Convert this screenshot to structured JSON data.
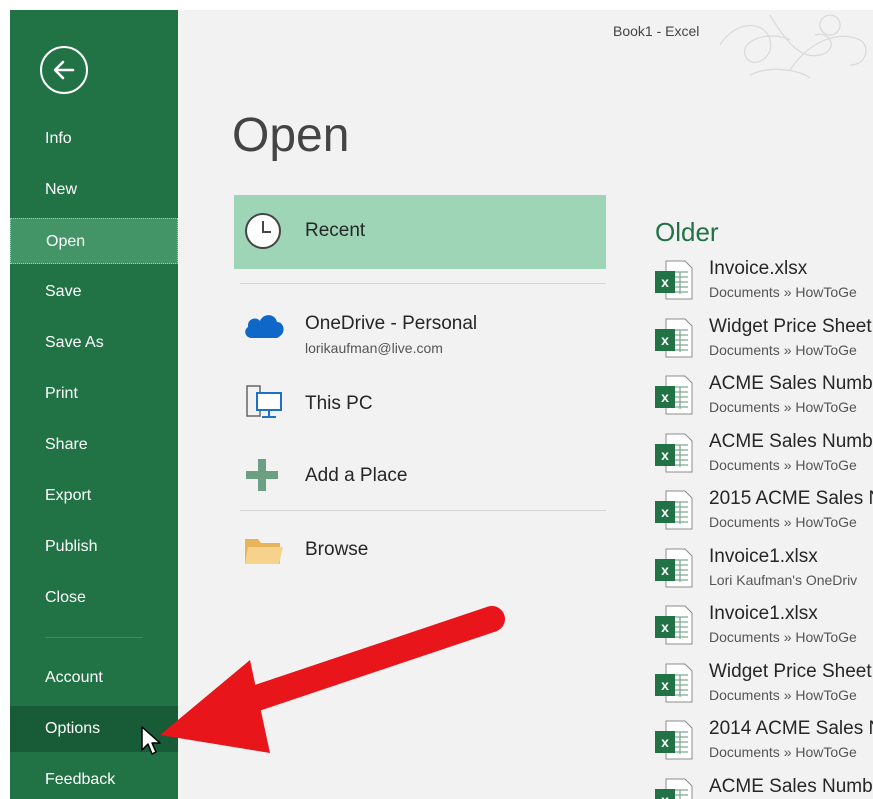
{
  "window": {
    "title": "Book1 - Excel"
  },
  "sidebar": {
    "back_label": "Back",
    "items": [
      {
        "label": "Info"
      },
      {
        "label": "New"
      },
      {
        "label": "Open"
      },
      {
        "label": "Save"
      },
      {
        "label": "Save As"
      },
      {
        "label": "Print"
      },
      {
        "label": "Share"
      },
      {
        "label": "Export"
      },
      {
        "label": "Publish"
      },
      {
        "label": "Close"
      },
      {
        "label": "Account"
      },
      {
        "label": "Options"
      },
      {
        "label": "Feedback"
      }
    ],
    "active_item": "Open",
    "highlighted_item": "Options"
  },
  "main": {
    "title": "Open",
    "places": {
      "recent": {
        "label": "Recent",
        "icon": "clock-icon"
      },
      "onedrive": {
        "label": "OneDrive - Personal",
        "account": "lorikaufman@live.com",
        "icon": "cloud-icon"
      },
      "this_pc": {
        "label": "This PC",
        "icon": "computer-icon"
      },
      "add_place": {
        "label": "Add a Place",
        "icon": "plus-icon"
      },
      "browse": {
        "label": "Browse",
        "icon": "folder-icon"
      }
    },
    "section_heading": "Older",
    "files": [
      {
        "name": "Invoice.xlsx",
        "path": "Documents » HowToGe"
      },
      {
        "name": "Widget Price Sheet",
        "path": "Documents » HowToGe"
      },
      {
        "name": "ACME Sales Numb",
        "path": "Documents » HowToGe"
      },
      {
        "name": "ACME Sales Numb",
        "path": "Documents » HowToGe"
      },
      {
        "name": "2015 ACME Sales N",
        "path": "Documents » HowToGe"
      },
      {
        "name": "Invoice1.xlsx",
        "path": "Lori Kaufman's OneDriv"
      },
      {
        "name": "Invoice1.xlsx",
        "path": "Documents » HowToGe"
      },
      {
        "name": "Widget Price Sheet",
        "path": "Documents » HowToGe"
      },
      {
        "name": "2014 ACME Sales N",
        "path": "Documents » HowToGe"
      },
      {
        "name": "ACME Sales Numb",
        "path": ""
      }
    ]
  },
  "colors": {
    "sidebar": "#217346",
    "sidebar_active": "#439467",
    "sidebar_hover": "#185c37",
    "selected_place": "#9fd5b7",
    "accent_green": "#217346",
    "annotation_arrow": "#e8151b"
  }
}
